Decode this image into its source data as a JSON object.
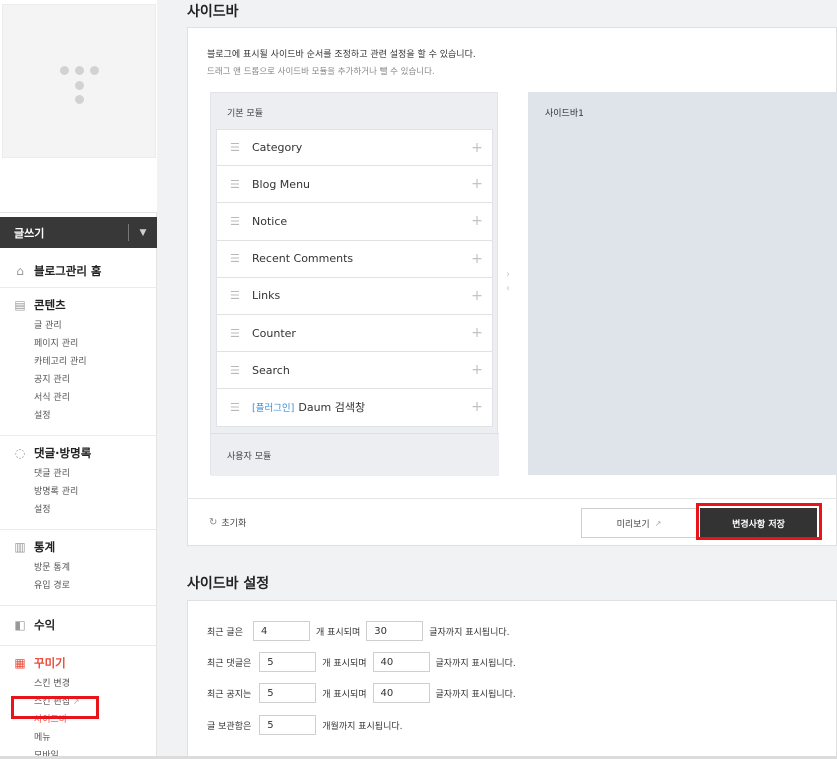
{
  "sidebar": {
    "write_label": "글쓰기",
    "groups": [
      {
        "title": "블로그관리 홈",
        "icon": "home-icon",
        "items": []
      },
      {
        "title": "콘텐츠",
        "icon": "document-icon",
        "items": [
          "글 관리",
          "페이지 관리",
          "카테고리 관리",
          "공지 관리",
          "서식 관리",
          "설정"
        ]
      },
      {
        "title": "댓글·방명록",
        "icon": "comment-icon",
        "items": [
          "댓글 관리",
          "방명록 관리",
          "설정"
        ]
      },
      {
        "title": "통계",
        "icon": "chart-icon",
        "items": [
          "방문 통계",
          "유입 경로"
        ]
      },
      {
        "title": "수익",
        "icon": "revenue-icon",
        "items": []
      },
      {
        "title": "꾸미기",
        "icon": "layout-icon",
        "items": [
          "스킨 변경",
          "스킨 편집",
          "사이드바",
          "메뉴",
          "모바일"
        ]
      }
    ]
  },
  "main": {
    "title": "사이드바",
    "desc1": "블로그에 표시될 사이드바 순서를 조정하고 관련 설정을 할 수 있습니다.",
    "desc2": "드래그 앤 드롭으로 사이드바 모듈을 추가하거나 뺄 수 있습니다.",
    "basic_modules_title": "기본 모듈",
    "modules": [
      "Category",
      "Blog Menu",
      "Notice",
      "Recent Comments",
      "Links",
      "Counter",
      "Search",
      "Daum 검색창"
    ],
    "plugin_tag": "[플러그인]",
    "user_modules_title": "사용자 모듈",
    "sidebar1_title": "사이드바1",
    "reset_label": "초기화",
    "preview_label": "미리보기",
    "save_label": "변경사항 저장"
  },
  "settings": {
    "title": "사이드바 설정",
    "rows": [
      {
        "label": "최근 글은",
        "v1": "4",
        "mid": "개 표시되며",
        "v2": "30",
        "end": "글자까지 표시됩니다."
      },
      {
        "label": "최근 댓글은",
        "v1": "5",
        "mid": "개 표시되며",
        "v2": "40",
        "end": "글자까지 표시됩니다."
      },
      {
        "label": "최근 공지는",
        "v1": "5",
        "mid": "개 표시되며",
        "v2": "40",
        "end": "글자까지 표시됩니다."
      },
      {
        "label": "글 보관함은",
        "v1": "5",
        "end": "개월까지 표시됩니다."
      }
    ]
  }
}
